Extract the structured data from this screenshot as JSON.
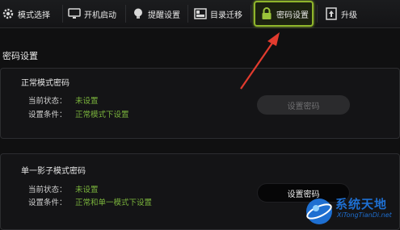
{
  "toolbar": {
    "tabs": [
      {
        "label": "模式选择",
        "icon": "gear-icon"
      },
      {
        "label": "开机启动",
        "icon": "monitor-icon"
      },
      {
        "label": "提醒设置",
        "icon": "lightbulb-icon"
      },
      {
        "label": "目录迁移",
        "icon": "folder-icon"
      },
      {
        "label": "密码设置",
        "icon": "lock-icon"
      },
      {
        "label": "升级",
        "icon": "upgrade-icon"
      }
    ],
    "active_index": 4
  },
  "page": {
    "title": "密码设置"
  },
  "normal": {
    "title": "正常模式密码",
    "status_label": "当前状态：",
    "status_value": "未设置",
    "cond_label": "设置条件：",
    "cond_value": "正常模式下设置",
    "button": "设置密码"
  },
  "single": {
    "title": "单一影子模式密码",
    "status_label": "当前状态：",
    "status_value": "未设置",
    "cond_label": "设置条件：",
    "cond_value": "正常和单一模式下设置",
    "button": "设置密码"
  },
  "watermark": {
    "title": "系统天地",
    "url": "XiTongTianDi.net"
  },
  "colors": {
    "accent": "#8fb52b",
    "value_green": "#7ab33c",
    "arrow": "#e23b2e",
    "watermark_blue": "#1e6fd1"
  }
}
